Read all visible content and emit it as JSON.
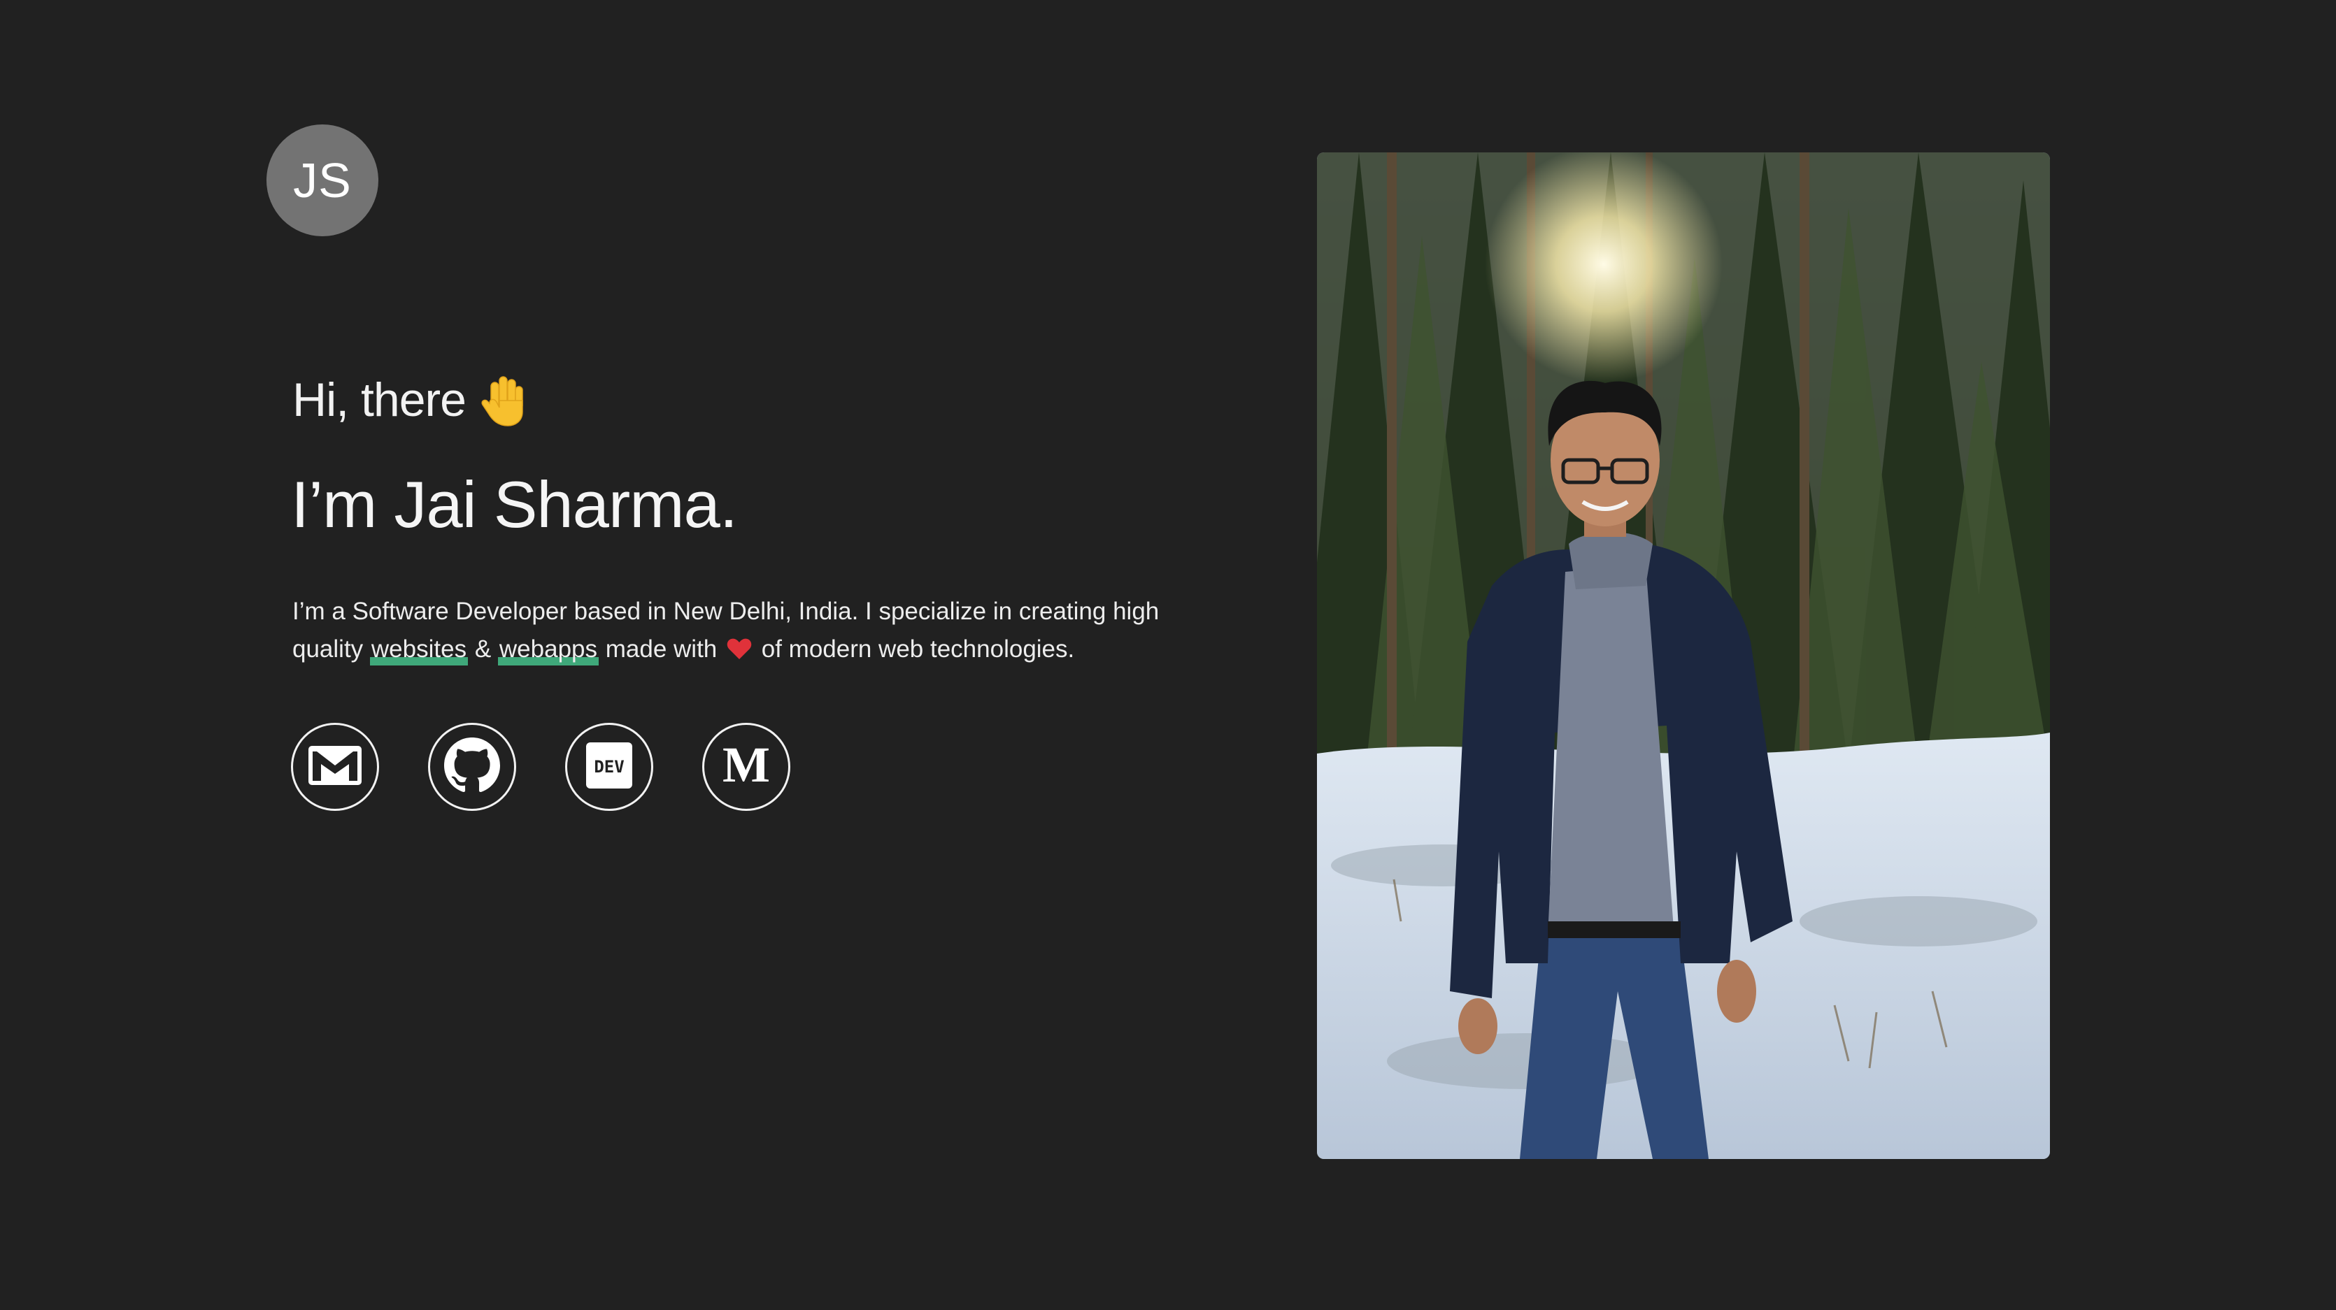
{
  "logo": {
    "initials": "JS"
  },
  "hero": {
    "greeting": "Hi, there",
    "name": "I’m Jai Sharma.",
    "bio": {
      "part1": "I’m a Software Developer based in New Delhi, India. I specialize in creating high quality",
      "link1": "websites",
      "amp": "&",
      "link2": "webapps",
      "part2": "made with",
      "part3": "of modern web technologies."
    }
  },
  "socials": [
    {
      "icon": "gmail-icon"
    },
    {
      "icon": "github-icon"
    },
    {
      "icon": "dev-icon",
      "label": "DEV"
    },
    {
      "icon": "medium-icon",
      "label": "M"
    }
  ],
  "colors": {
    "background": "#212121",
    "logo_bg": "#737373",
    "highlight": "#3fa87a",
    "heart": "#e0323a"
  }
}
